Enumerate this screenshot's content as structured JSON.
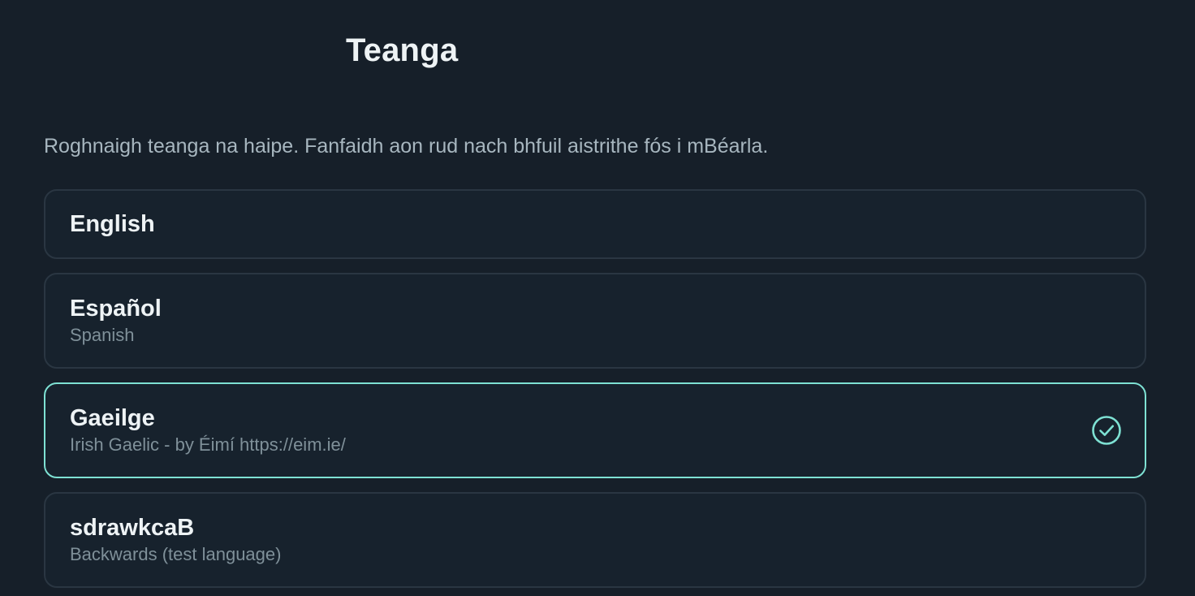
{
  "header": {
    "title": "Teanga"
  },
  "description": "Roghnaigh teanga na haipe. Fanfaidh aon rud nach bhfuil aistrithe fós i mBéarla.",
  "languages": [
    {
      "name": "English",
      "subtitle": "",
      "selected": false
    },
    {
      "name": "Español",
      "subtitle": "Spanish",
      "selected": false
    },
    {
      "name": "Gaeilge",
      "subtitle": "Irish Gaelic - by Éimí https://eim.ie/",
      "selected": true
    },
    {
      "name": "sdrawkcaB",
      "subtitle": "Backwards (test language)",
      "selected": false
    }
  ],
  "icons": {
    "selected_indicator": "check-circle-icon"
  },
  "colors": {
    "background": "#161f29",
    "card": "#17222d",
    "accent": "#7ee1d3"
  }
}
